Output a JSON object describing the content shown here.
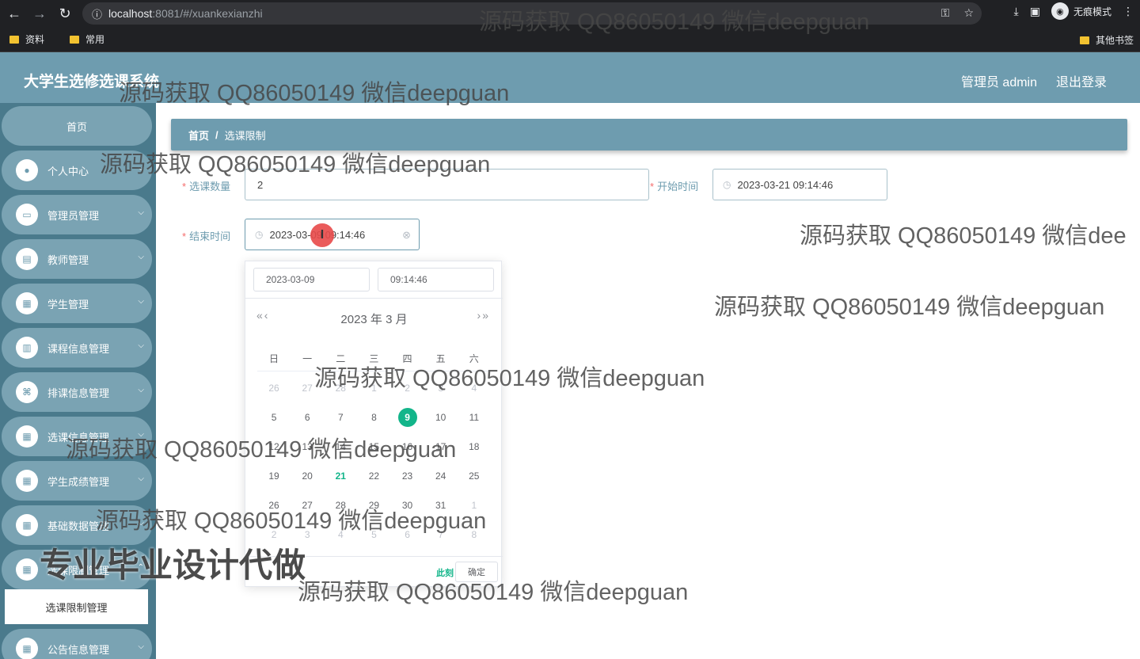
{
  "browser": {
    "url_host": "localhost",
    "url_rest": ":8081/#/xuankexianzhi",
    "incognito_label": "无痕模式",
    "bookmarks": [
      "资料",
      "常用"
    ],
    "other_bookmarks": "其他书签"
  },
  "app": {
    "title": "大学生选修选课系统",
    "user": "管理员 admin",
    "logout": "退出登录"
  },
  "sidebar": {
    "home": "首页",
    "items": [
      "个人中心",
      "管理员管理",
      "教师管理",
      "学生管理",
      "课程信息管理",
      "排课信息管理",
      "选课信息管理",
      "学生成绩管理",
      "基础数据管理",
      "选课限制管理",
      "公告信息管理"
    ],
    "active_sub": "选课限制管理"
  },
  "breadcrumb": {
    "home": "首页",
    "sep": "/",
    "current": "选课限制"
  },
  "form": {
    "count_label": "选课数量",
    "count_value": "2",
    "start_label": "开始时间",
    "start_value": "2023-03-21 09:14:46",
    "end_label": "结束时间",
    "end_value": "2023-03-09 09:14:46"
  },
  "picker": {
    "date_input": "2023-03-09",
    "time_input": "09:14:46",
    "title": "2023 年  3 月",
    "weekdays": [
      "日",
      "一",
      "二",
      "三",
      "四",
      "五",
      "六"
    ],
    "weeks": [
      [
        "26",
        "27",
        "28",
        "1",
        "2",
        "3",
        "4"
      ],
      [
        "5",
        "6",
        "7",
        "8",
        "9",
        "10",
        "11"
      ],
      [
        "12",
        "13",
        "14",
        "15",
        "16",
        "17",
        "18"
      ],
      [
        "19",
        "20",
        "21",
        "22",
        "23",
        "24",
        "25"
      ],
      [
        "26",
        "27",
        "28",
        "29",
        "30",
        "31",
        "1"
      ],
      [
        "2",
        "3",
        "4",
        "5",
        "6",
        "7",
        "8"
      ]
    ],
    "now": "此刻",
    "ok": "确定"
  },
  "watermarks": {
    "text": "源码获取 QQ86050149 微信deepguan",
    "text_cut": "源码获取 QQ86050149 微信dee",
    "big": "专业毕业设计代做"
  },
  "colors": {
    "header": "#6e9caf",
    "sidebar": "#4a7a8c",
    "accent": "#13b58a"
  }
}
